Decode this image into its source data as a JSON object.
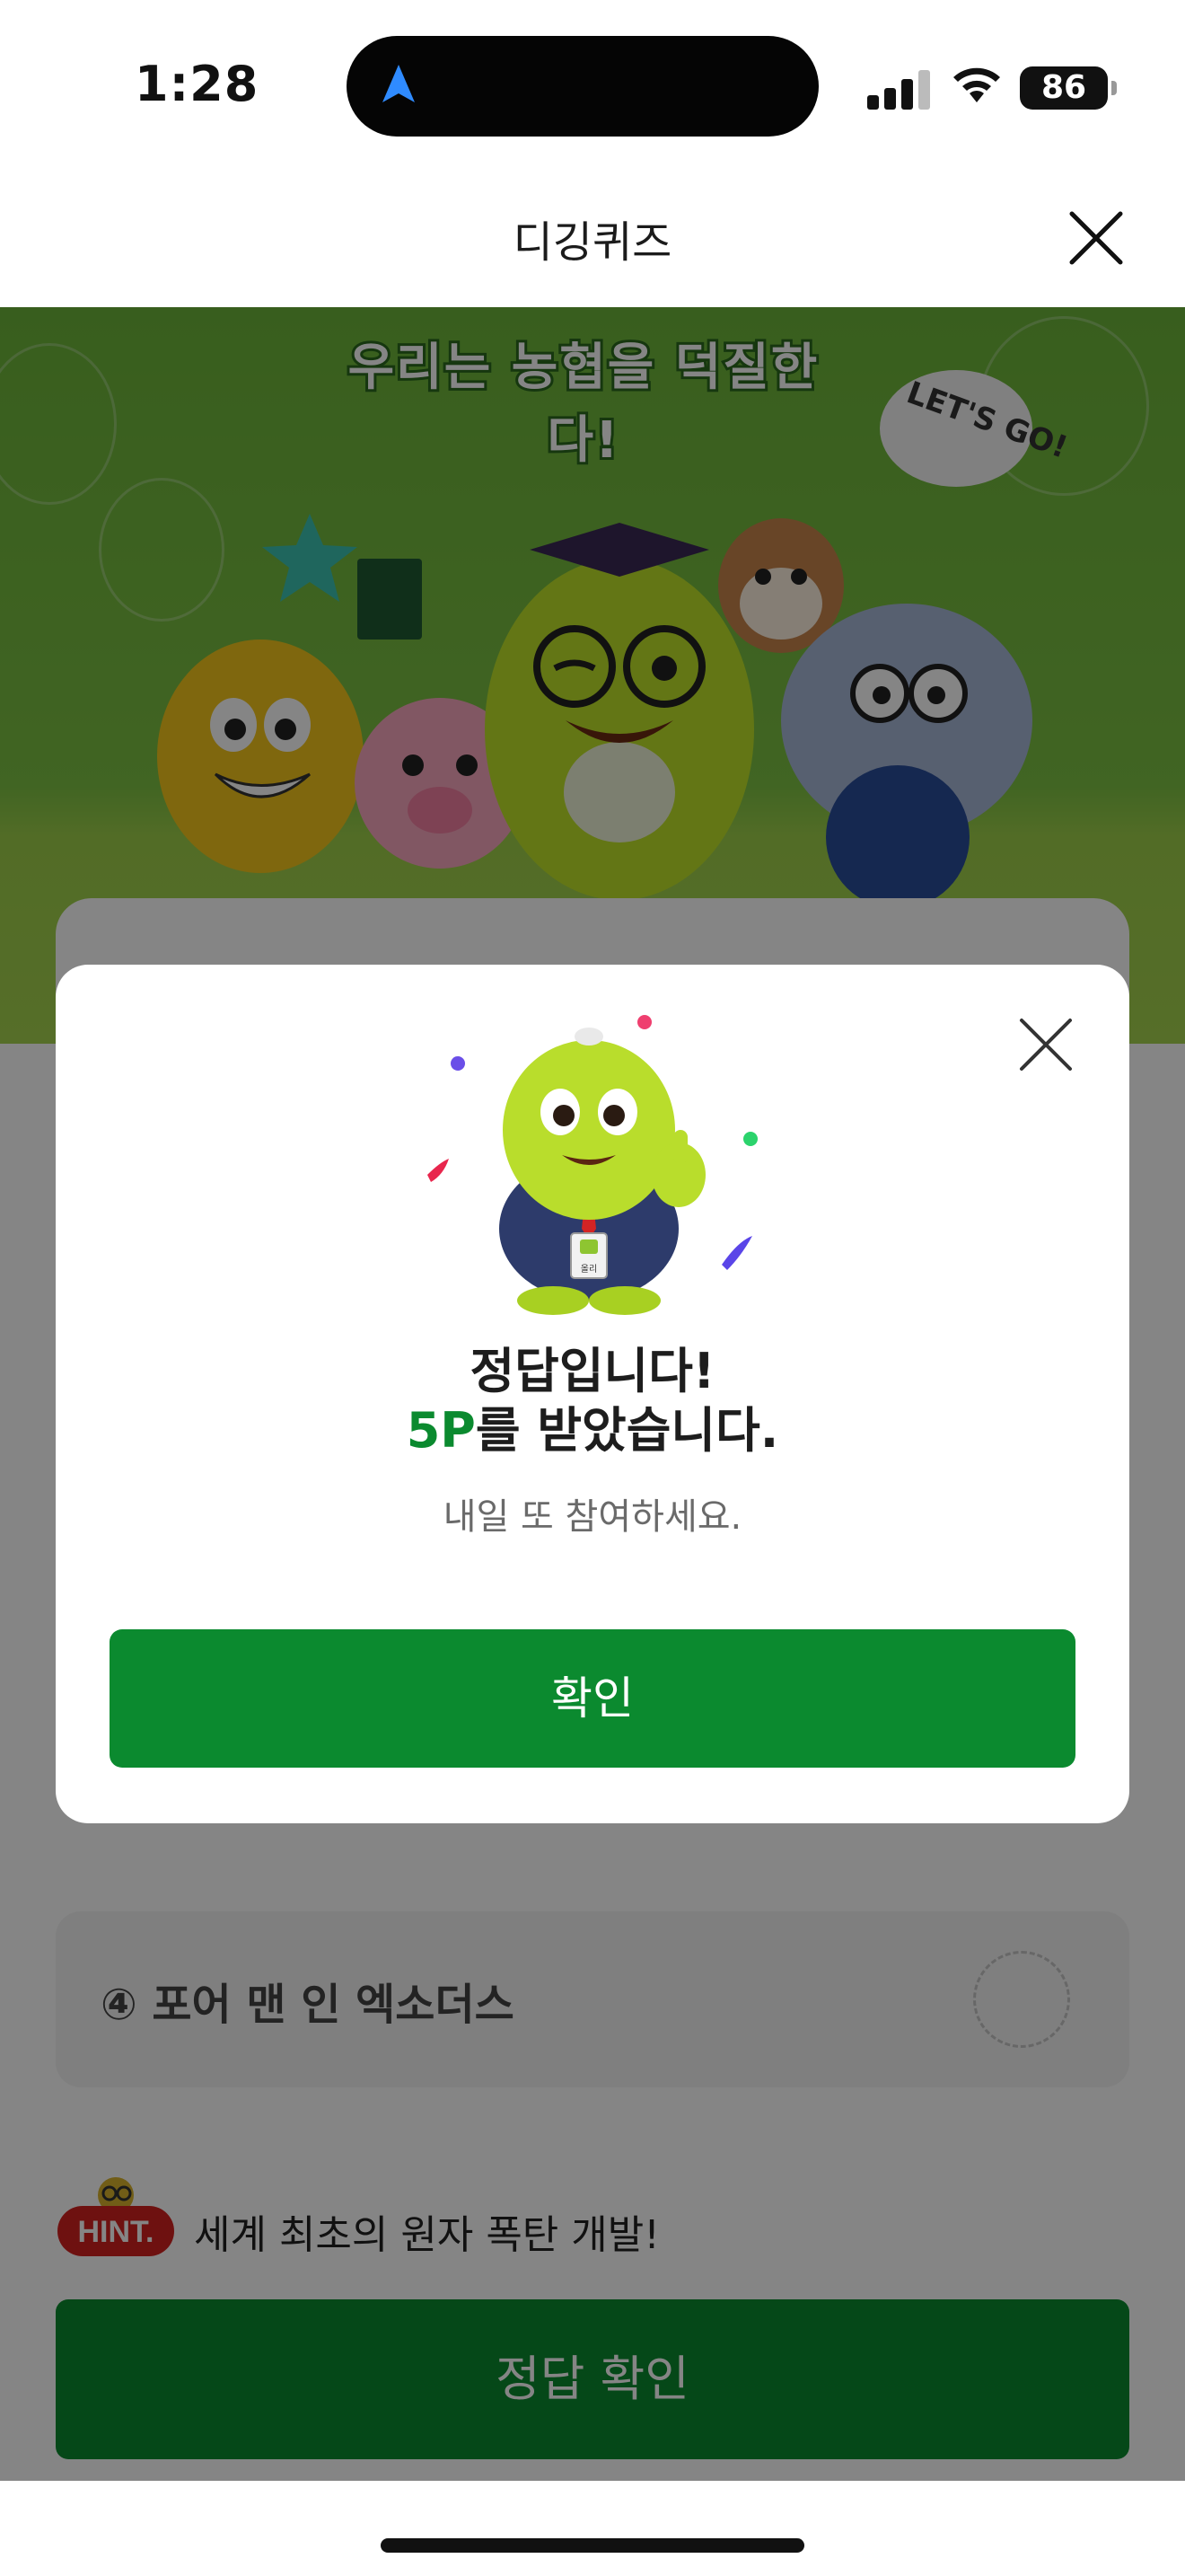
{
  "status_bar": {
    "time": "1:28",
    "battery": "86"
  },
  "header": {
    "title": "디깅퀴즈"
  },
  "hero": {
    "slogan": "우리는 농협을 덕질한다!",
    "bubble_text": "LET'S GO!"
  },
  "options": [
    {
      "label": "④ 포어 맨 인 엑소더스"
    }
  ],
  "hint": {
    "badge": "HINT.",
    "text": "세계 최초의 원자 폭탄 개발!"
  },
  "submit": {
    "label": "정답 확인"
  },
  "modal": {
    "title": "정답입니다!",
    "points": "5P",
    "points_suffix": "를 받았습니다.",
    "subtitle": "내일 또 참여하세요.",
    "confirm_label": "확인",
    "mascot_badge": "올리"
  },
  "colors": {
    "brand_green": "#0b8a2f",
    "hero_green": "#7dc143"
  },
  "icons": [
    "location-arrow-icon",
    "signal-icon",
    "wifi-icon",
    "battery-icon",
    "close-icon",
    "mascot-illustration",
    "hint-badge-icon"
  ]
}
